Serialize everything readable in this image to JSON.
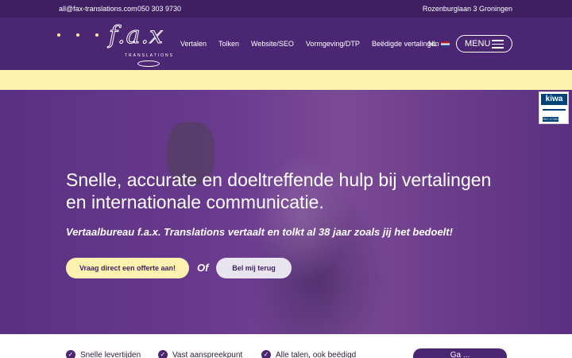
{
  "topbar": {
    "email": "all@fax-translations.com",
    "phone": "050 303 9730",
    "address": "Rozenburglaan 3 Groningen"
  },
  "logo": {
    "text": "f.a.x",
    "subtitle": "TRANSLATIONS"
  },
  "nav": {
    "items": [
      "Vertalen",
      "Tolken",
      "Website/SEO",
      "Vormgeving/DTP",
      "Beëdigde vertalingen"
    ],
    "language": "NL",
    "menu_label": "MENU"
  },
  "hero": {
    "headline": "Snelle, accurate en doeltreffende hulp bij vertalingen en internationale communicatie.",
    "subheadline": "Vertaalbureau f.a.x. Translations vertaalt en tolkt al 38 jaar zoals jij het bedoelt!",
    "primary_button": "Vraag direct een offerte aan!",
    "or_text": "Of",
    "secondary_button": "Bel mij terug"
  },
  "badge": {
    "brand": "kiwa",
    "iso": "ISO 17100"
  },
  "features": {
    "items": [
      "Snelle levertijden",
      "Vast aanspreekpunt",
      "Alle talen, ook beëdigd"
    ],
    "cta_label": "Ga ..."
  },
  "colors": {
    "purple_dark": "#3f1f62",
    "purple": "#4b2673",
    "yellow": "#fff1b0"
  }
}
